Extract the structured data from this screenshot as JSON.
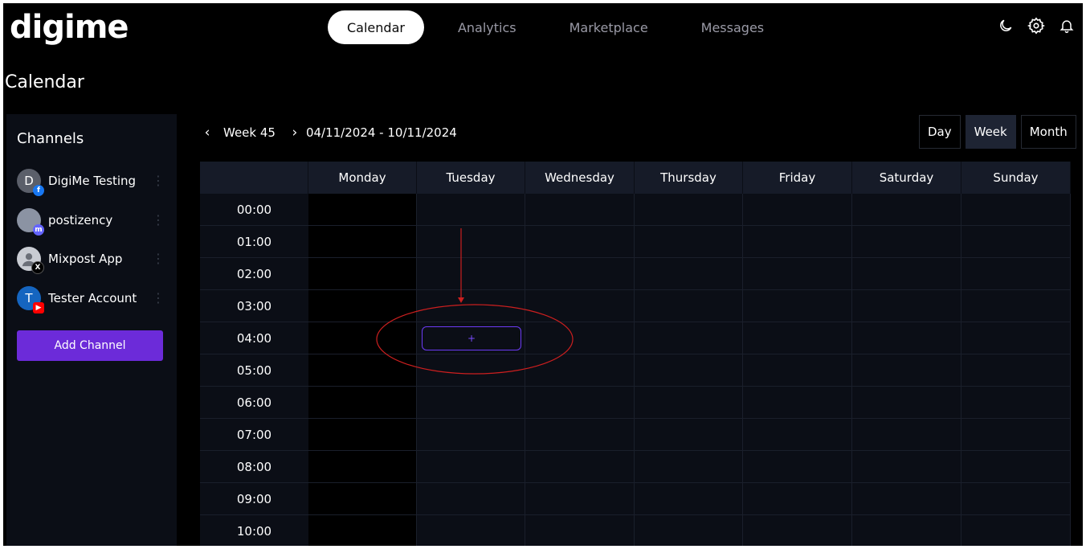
{
  "app": {
    "logo": "digime"
  },
  "nav": {
    "tabs": [
      "Calendar",
      "Analytics",
      "Marketplace",
      "Messages"
    ],
    "active": "Calendar"
  },
  "page": {
    "title": "Calendar"
  },
  "sidebar": {
    "title": "Channels",
    "channels": [
      {
        "name": "DigiMe Testing",
        "initial": "D",
        "platform": "facebook-icon",
        "badge_color": "#1877f2"
      },
      {
        "name": "postizency",
        "initial": "",
        "platform": "mastodon-icon",
        "badge_color": "#6364ff"
      },
      {
        "name": "Mixpost App",
        "initial": "",
        "platform": "x-icon",
        "badge_color": "#000000"
      },
      {
        "name": "Tester Account",
        "initial": "T",
        "platform": "youtube-icon",
        "badge_color": "#ff0000"
      }
    ],
    "add_button": "Add Channel"
  },
  "calendar": {
    "week_label": "Week 45",
    "date_range": "04/11/2024 - 10/11/2024",
    "views": [
      "Day",
      "Week",
      "Month"
    ],
    "active_view": "Week",
    "days": [
      "Monday",
      "Tuesday",
      "Wednesday",
      "Thursday",
      "Friday",
      "Saturday",
      "Sunday"
    ],
    "hours": [
      "00:00",
      "01:00",
      "02:00",
      "03:00",
      "04:00",
      "05:00",
      "06:00",
      "07:00",
      "08:00",
      "09:00",
      "10:00"
    ],
    "add_slot_label": "+"
  },
  "colors": {
    "accent": "#6c2bd9",
    "annotation": "#cc1f1f"
  }
}
